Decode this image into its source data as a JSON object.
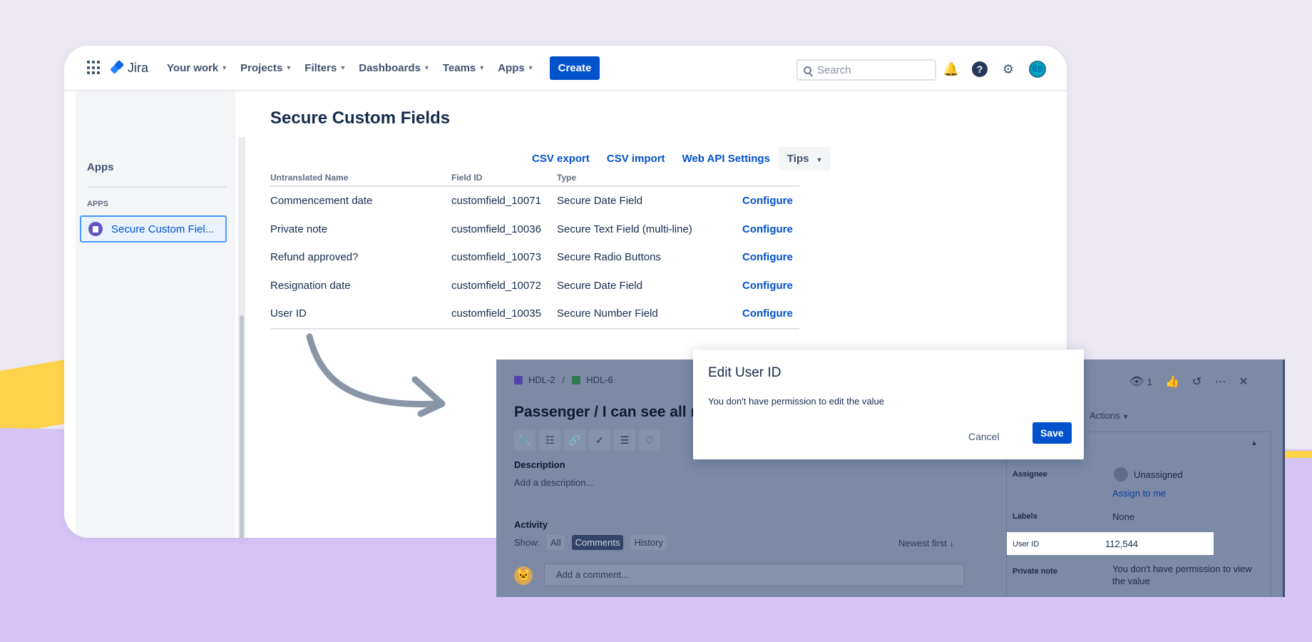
{
  "jira": {
    "logo_text": "Jira",
    "nav_items": [
      "Your work",
      "Projects",
      "Filters",
      "Dashboards",
      "Teams",
      "Apps"
    ],
    "create_label": "Create",
    "search_placeholder": "Search",
    "avatar_initials": "ES",
    "sidebar": {
      "title": "Apps",
      "section": "APPS",
      "active_item": "Secure Custom Fiel..."
    },
    "page_title": "Secure Custom Fields",
    "actions": {
      "csv_export": "CSV export",
      "csv_import": "CSV import",
      "web_api": "Web API Settings",
      "tips": "Tips"
    },
    "table": {
      "headers": [
        "Untranslated Name",
        "Field ID",
        "Type",
        ""
      ],
      "rows": [
        {
          "name": "Commencement date",
          "id": "customfield_10071",
          "type": "Secure Date Field",
          "action": "Configure"
        },
        {
          "name": "Private note",
          "id": "customfield_10036",
          "type": "Secure Text Field (multi-line)",
          "action": "Configure"
        },
        {
          "name": "Refund approved?",
          "id": "customfield_10073",
          "type": "Secure Radio Buttons",
          "action": "Configure"
        },
        {
          "name": "Resignation date",
          "id": "customfield_10072",
          "type": "Secure Date Field",
          "action": "Configure"
        },
        {
          "name": "User ID",
          "id": "customfield_10035",
          "type": "Secure Number Field",
          "action": "Configure"
        }
      ]
    }
  },
  "issue": {
    "breadcrumb_parent": "HDL-2",
    "breadcrumb_sep": "/",
    "breadcrumb_child": "HDL-6",
    "title": "Passenger / I can see all my u",
    "description_label": "Description",
    "description_placeholder": "Add a description...",
    "activity_label": "Activity",
    "show_label": "Show:",
    "filters": [
      "All",
      "Comments",
      "History"
    ],
    "sort_label": "Newest first",
    "comment_placeholder": "Add a comment...",
    "watchers": "1",
    "actions_label": "Actions",
    "details": {
      "assignee_label": "Assignee",
      "assignee_value": "Unassigned",
      "assign_to_me": "Assign to me",
      "labels_label": "Labels",
      "labels_value": "None",
      "userid_label": "User ID",
      "userid_value": "112,544",
      "private_note_label": "Private note",
      "private_note_value_1": "You don't have permission to view",
      "private_note_value_2": "the value"
    }
  },
  "modal": {
    "title": "Edit User ID",
    "message": "You don't have permission to edit the value",
    "cancel": "Cancel",
    "save": "Save"
  }
}
